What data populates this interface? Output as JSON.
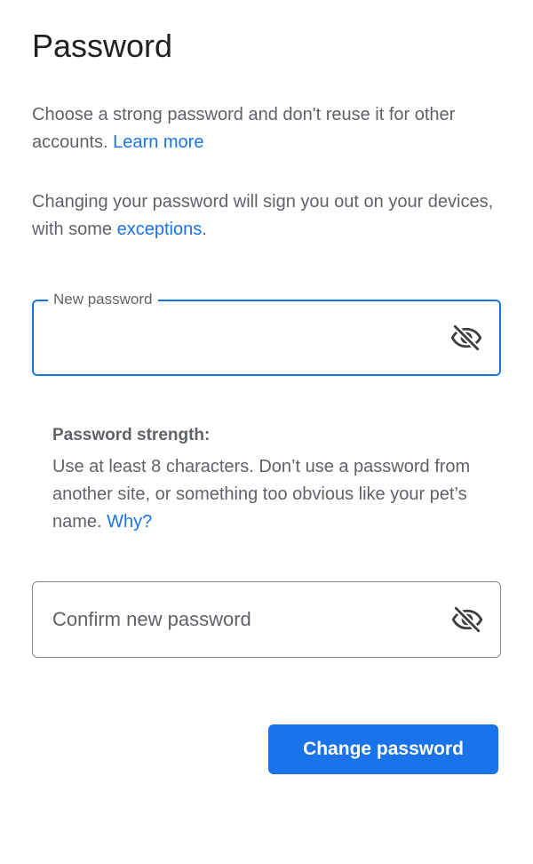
{
  "page": {
    "title": "Password"
  },
  "intro": {
    "text": "Choose a strong password and don't reuse it for other accounts. ",
    "link_label": "Learn more"
  },
  "signout_notice": {
    "text_before": "Changing your password will sign you out on your devices, with some ",
    "link_label": "exceptions",
    "text_after": "."
  },
  "new_password": {
    "label": "New password",
    "value": "",
    "toggle_icon": "visibility-off-icon"
  },
  "strength": {
    "title": "Password strength:",
    "text": "Use at least 8 characters. Don’t use a password from another site, or something too obvious like your pet’s name. ",
    "link_label": "Why?"
  },
  "confirm_password": {
    "placeholder": "Confirm new password",
    "value": "",
    "toggle_icon": "visibility-off-icon"
  },
  "actions": {
    "submit_label": "Change password"
  },
  "colors": {
    "accent": "#1a73e8",
    "text_primary": "#202124",
    "text_secondary": "#5f6368",
    "border": "#80868b"
  }
}
